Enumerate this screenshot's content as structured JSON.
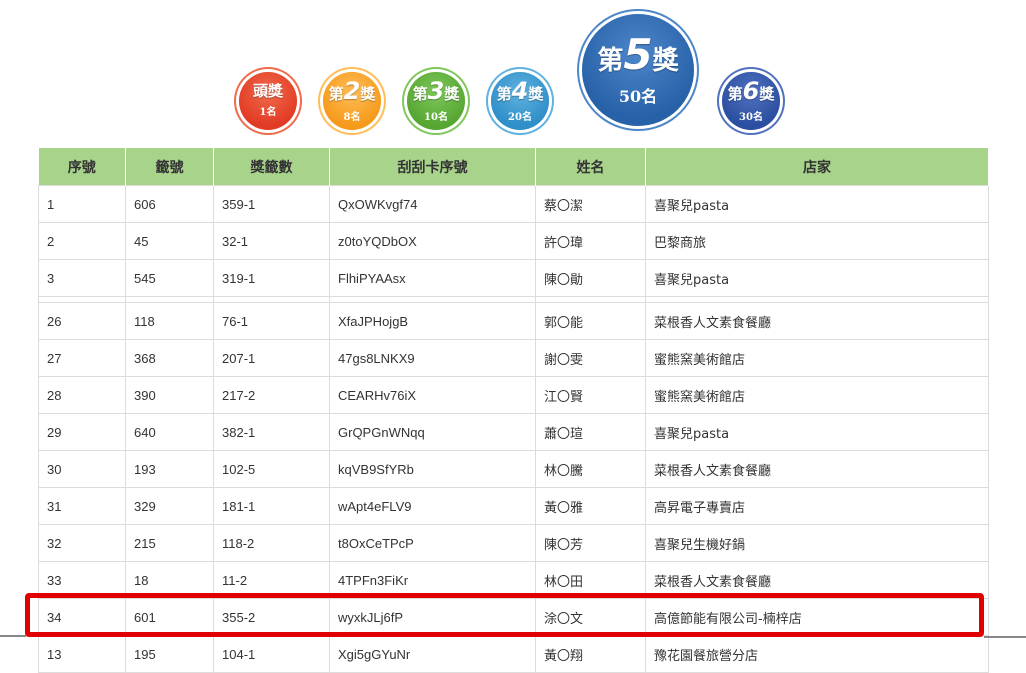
{
  "prizes": [
    {
      "label": "頭獎",
      "num": "",
      "count": "1名",
      "color": "#e23b25",
      "rim": "#f06a4b"
    },
    {
      "label": "第",
      "num": "2",
      "suffix": "獎",
      "count": "8名",
      "color": "#f59a1b",
      "rim": "#ffbd58"
    },
    {
      "label": "第",
      "num": "3",
      "suffix": "獎",
      "count": "10名",
      "color": "#56a632",
      "rim": "#7fc75a"
    },
    {
      "label": "第",
      "num": "4",
      "suffix": "獎",
      "count": "20名",
      "color": "#2f8fc8",
      "rim": "#5fb2e0"
    },
    {
      "label": "第",
      "num": "5",
      "suffix": "獎",
      "count": "50名",
      "color": "#2761a8",
      "rim": "#4d86c9"
    },
    {
      "label": "第",
      "num": "6",
      "suffix": "獎",
      "count": "30名",
      "color": "#2b4fa0",
      "rim": "#5071c0"
    }
  ],
  "table": {
    "headers": [
      "序號",
      "籤號",
      "獎籤數",
      "刮刮卡序號",
      "姓名",
      "店家"
    ],
    "rows": [
      [
        "1",
        "606",
        "359-1",
        "QxOWKvgf74",
        "蔡〇潔",
        "喜聚兒pasta"
      ],
      [
        "2",
        "45",
        "32-1",
        "z0toYQDbOX",
        "許〇瑋",
        "巴黎商旅"
      ],
      [
        "3",
        "545",
        "319-1",
        "FlhiPYAAsx",
        "陳〇勛",
        "喜聚兒pasta"
      ],
      [
        "26",
        "118",
        "76-1",
        "XfaJPHojgB",
        "郭〇能",
        "菜根香人文素食餐廳"
      ],
      [
        "27",
        "368",
        "207-1",
        "47gs8LNKX9",
        "謝〇雯",
        "蜜熊窯美術館店"
      ],
      [
        "28",
        "390",
        "217-2",
        "CEARHv76iX",
        "江〇賢",
        "蜜熊窯美術館店"
      ],
      [
        "29",
        "640",
        "382-1",
        "GrQPGnWNqq",
        "蕭〇瑄",
        "喜聚兒pasta"
      ],
      [
        "30",
        "193",
        "102-5",
        "kqVB9SfYRb",
        "林〇騰",
        "菜根香人文素食餐廳"
      ],
      [
        "31",
        "329",
        "181-1",
        "wApt4eFLV9",
        "黃〇雅",
        "高昇電子專賣店"
      ],
      [
        "32",
        "215",
        "118-2",
        "t8OxCeTPcP",
        "陳〇芳",
        "喜聚兒生機好鍋"
      ],
      [
        "33",
        "18",
        "11-2",
        "4TPFn3FiKr",
        "林〇田",
        "菜根香人文素食餐廳"
      ],
      [
        "34",
        "601",
        "355-2",
        "wyxkJLj6fP",
        "涂〇文",
        "高億節能有限公司-楠梓店"
      ],
      [
        "13",
        "195",
        "104-1",
        "Xgi5gGYuNr",
        "黃〇翔",
        "豫花園餐旅營分店"
      ]
    ]
  }
}
